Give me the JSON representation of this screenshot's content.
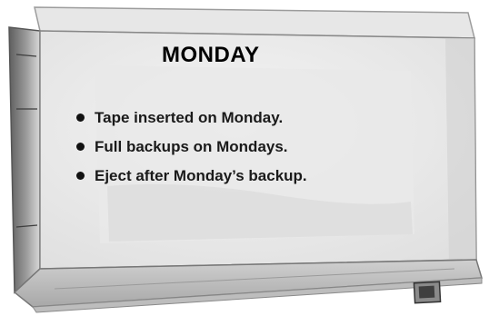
{
  "label": {
    "title": "MONDAY",
    "items": [
      "Tape inserted on Monday.",
      "Full backups on Mondays.",
      "Eject after Monday’s backup."
    ]
  },
  "object": "tape-cartridge"
}
